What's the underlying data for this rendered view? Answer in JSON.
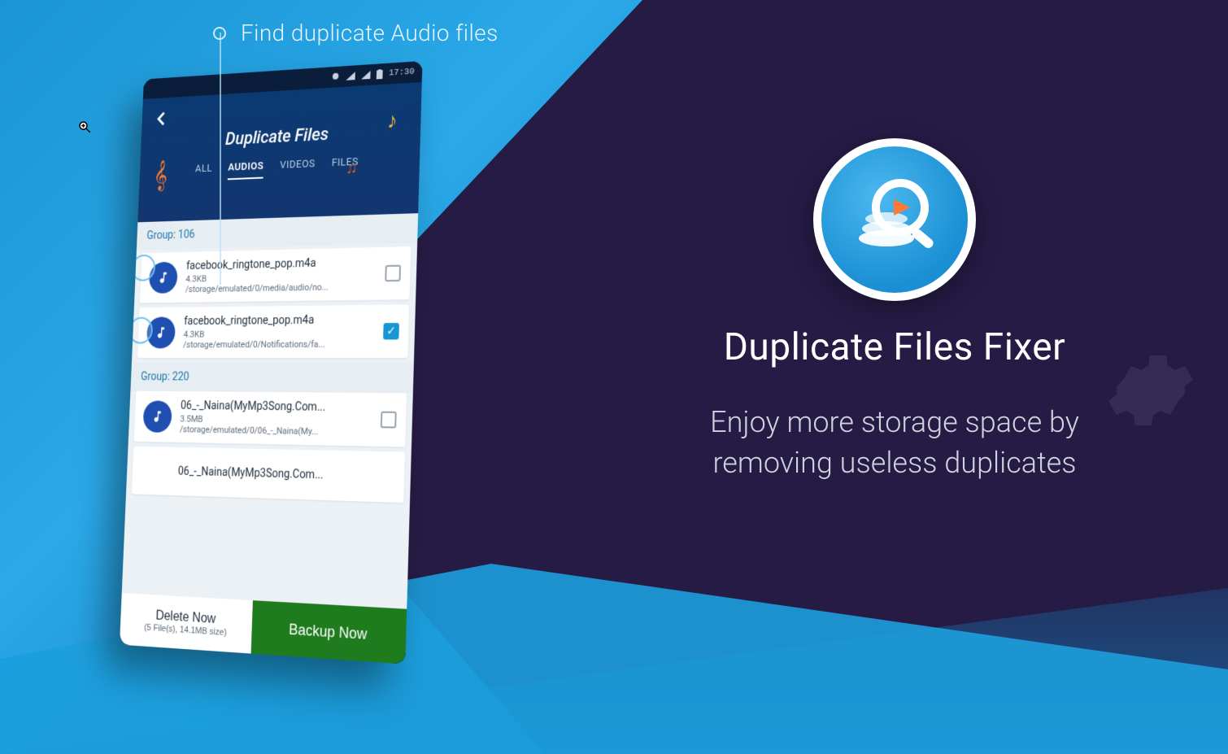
{
  "annotation": "Find duplicate Audio files",
  "promo": {
    "title": "Duplicate Files Fixer",
    "subtitle_line1": "Enjoy more storage space by",
    "subtitle_line2": "removing useless duplicates"
  },
  "phone": {
    "statusbar_time": "17:30",
    "header_title": "Duplicate Files",
    "tabs": {
      "all": "ALL",
      "audios": "AUDIOS",
      "videos": "VIDEOS",
      "files": "FILES"
    },
    "groups": [
      {
        "label": "Group: 106",
        "items": [
          {
            "name": "facebook_ringtone_pop.m4a",
            "size": "4.3KB",
            "path": "/storage/emulated/0/media/audio/no...",
            "checked": false
          },
          {
            "name": "facebook_ringtone_pop.m4a",
            "size": "4.3KB",
            "path": "/storage/emulated/0/Notifications/fa...",
            "checked": true
          }
        ]
      },
      {
        "label": "Group: 220",
        "items": [
          {
            "name": "06_-_Naina(MyMp3Song.Com...",
            "size": "3.5MB",
            "path": "/storage/emulated/0/06_-_Naina(My...",
            "checked": false
          },
          {
            "name": "06_-_Naina(MyMp3Song.Com...",
            "size": "",
            "path": "",
            "checked": false
          }
        ]
      }
    ],
    "delete_label": "Delete Now",
    "delete_sub": "(5 File(s), 14.1MB size)",
    "backup_label": "Backup Now"
  }
}
